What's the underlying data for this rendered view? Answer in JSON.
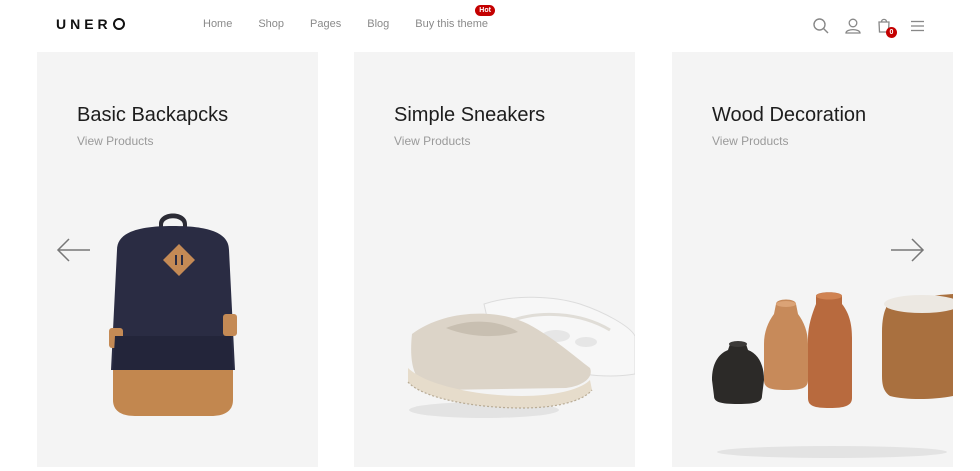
{
  "header": {
    "logo": "UNER",
    "nav": [
      {
        "label": "Home"
      },
      {
        "label": "Shop"
      },
      {
        "label": "Pages"
      },
      {
        "label": "Blog"
      },
      {
        "label": "Buy this theme",
        "badge": "Hot"
      }
    ],
    "icons": [
      "search-icon",
      "user-icon",
      "cart-icon",
      "menu-icon"
    ],
    "cart_count": "0"
  },
  "slides": [
    {
      "title": "Basic Backapcks",
      "link": "View Products"
    },
    {
      "title": "Simple Sneakers",
      "link": "View Products"
    },
    {
      "title": "Wood Decoration",
      "link": "View Products"
    }
  ],
  "colors": {
    "accent": "#c40000",
    "panel_bg": "#f4f4f4",
    "nav_text": "#8a8a8a"
  }
}
